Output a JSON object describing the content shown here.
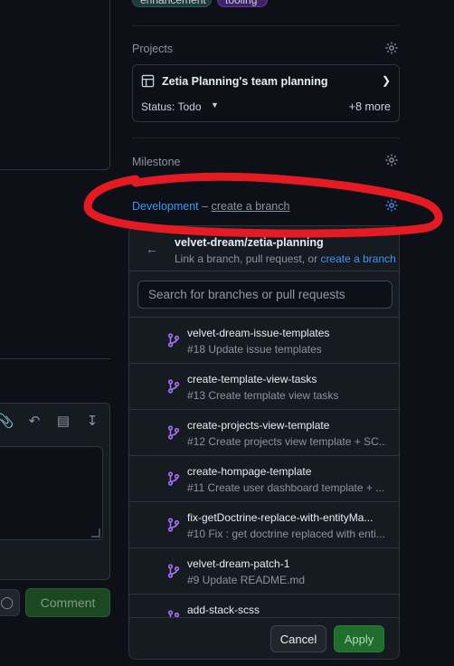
{
  "labels": [
    "enhancement",
    "tooling"
  ],
  "projects": {
    "title": "Projects",
    "project_name": "Zetia Planning's team planning",
    "status": "Status: Todo",
    "more": "+8 more"
  },
  "milestone": {
    "title": "Milestone"
  },
  "development": {
    "title": "Development",
    "separator": "–",
    "link": "create a branch"
  },
  "dropdown": {
    "repo": "velvet-dream/zetia-planning",
    "subtitle_prefix": "Link a branch, pull request, or ",
    "subtitle_link": "create a branch",
    "search_placeholder": "Search for branches or pull requests",
    "items": [
      {
        "name": "velvet-dream-issue-templates",
        "desc": "#18 Update issue templates"
      },
      {
        "name": "create-template-view-tasks",
        "desc": "#13 Create template view tasks"
      },
      {
        "name": "create-projects-view-template",
        "desc": "#12 Create projects view template + SC..."
      },
      {
        "name": "create-hompage-template",
        "desc": "#11 Create user dashboard template + ..."
      },
      {
        "name": "fix-getDoctrine-replace-with-entityMa...",
        "desc": "#10 Fix : get doctrine replaced with enti..."
      },
      {
        "name": "velvet-dream-patch-1",
        "desc": "#9 Update README.md"
      },
      {
        "name": "add-stack-scss",
        "desc": ""
      }
    ],
    "cancel_label": "Cancel",
    "apply_label": "Apply"
  },
  "editor": {
    "comment_label": "Comment"
  },
  "colors": {
    "background": "#0d1117",
    "accent_link": "#4493f8",
    "branch_icon": "#a371f7",
    "annotation": "#e41b23",
    "apply_button": "#1f6e2c"
  }
}
